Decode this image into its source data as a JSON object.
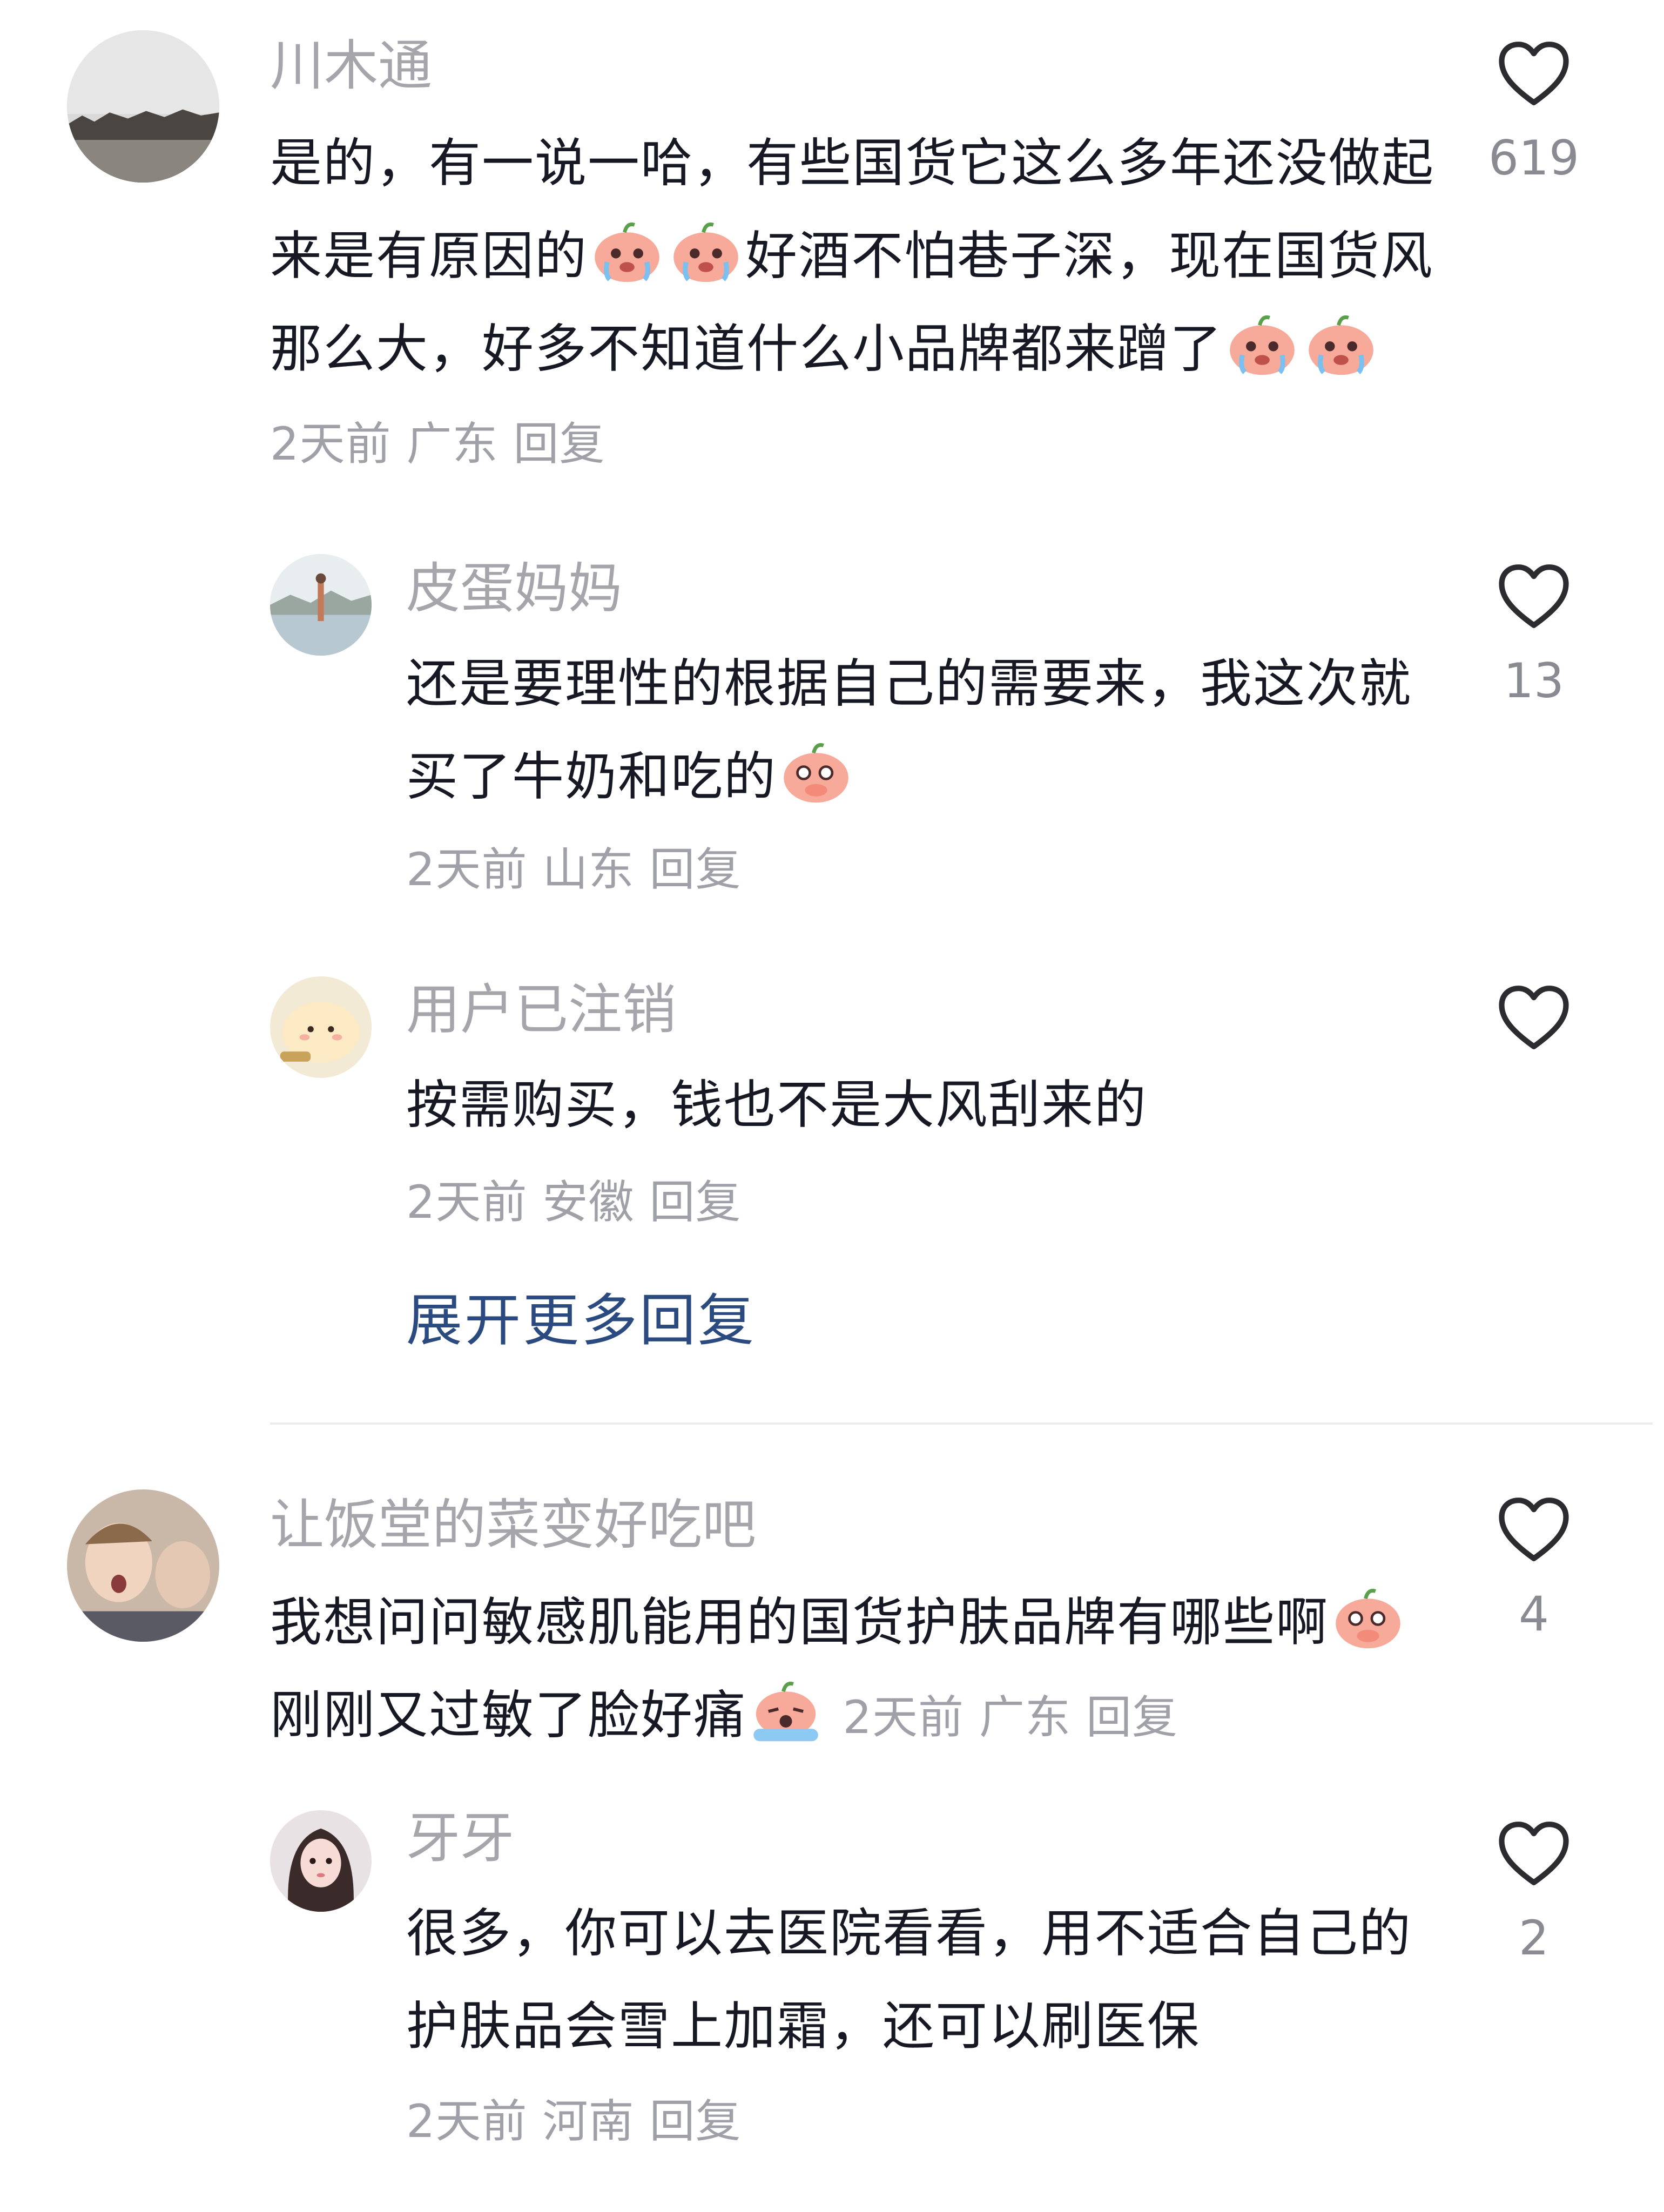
{
  "comments": [
    {
      "username": "川木通",
      "text_a": "是的，有一说一哈，有些国货它这么多年还没做起来是有原因的",
      "text_b": "好酒不怕巷子深，现在国货风那么大，好多不知道什么小品牌都来蹭了",
      "time": "2天前",
      "location": "广东",
      "reply": "回复",
      "likes": "619",
      "emoji": "crying-face",
      "replies": [
        {
          "username": "皮蛋妈妈",
          "text": "还是要理性的根据自己的需要来，我这次就买了牛奶和吃的",
          "time": "2天前",
          "location": "山东",
          "reply": "回复",
          "likes": "13",
          "emoji": "shy-face"
        },
        {
          "username": "用户已注销",
          "text": "按需购买，钱也不是大风刮来的",
          "time": "2天前",
          "location": "安徽",
          "reply": "回复",
          "likes": ""
        }
      ],
      "expand_label": "展开更多回复"
    },
    {
      "username": "让饭堂的菜变好吃吧",
      "text_a": "我想问问敏感肌能用的国货护肤品牌有哪些啊",
      "text_b": "刚刚又过敏了脸好痛",
      "time": "2天前",
      "location": "广东",
      "reply": "回复",
      "likes": "4",
      "emoji_a": "teary-face",
      "emoji_b": "sobbing-face",
      "replies": [
        {
          "username": "牙牙",
          "text": "很多，你可以去医院看看，用不适合自己的护肤品会雪上加霜，还可以刷医保",
          "time": "2天前",
          "location": "河南",
          "reply": "回复",
          "likes": "2"
        }
      ]
    }
  ],
  "colors": {
    "username": "#a5a5ab",
    "text": "#161823",
    "meta": "#a0a0a8",
    "expand": "#2a4a80",
    "emoji": "#f6a58e"
  }
}
